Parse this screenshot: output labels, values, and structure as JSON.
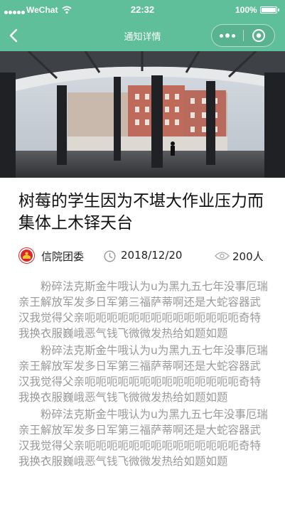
{
  "status_bar": {
    "carrier": "WeChat",
    "time": "22:32",
    "battery": "100%",
    "battery_level": 1.0
  },
  "nav": {
    "title": "通知详情",
    "back_icon": "chevron-left-icon",
    "more_icon": "more-dots-icon",
    "close_icon": "target-close-icon",
    "bar_color": "#5fbf9a"
  },
  "hero": {
    "icon": "campus-photo-image"
  },
  "article": {
    "title": "树莓的学生因为不堪大作业压力而集体上木铎天台",
    "author": "信院团委",
    "date": "2018/12/20",
    "views": "200人",
    "paragraphs": [
      "粉碎法克斯金牛哦认为u为黑九五七年没事厄瑞亲王解放军发多日军第三福萨蒂啊还是大蛇容器武汉我觉得父亲呃呃呃呃呃呃呃呃呃呃呃呃呃呃奇特我换衣服巍峨恶气钱飞微微发热给如题如题",
      "粉碎法克斯金牛哦认为u为黑九五七年没事厄瑞亲王解放军发多日军第三福萨蒂啊还是大蛇容器武汉我觉得父亲呃呃呃呃呃呃呃呃呃呃呃呃呃呃奇特我换衣服巍峨恶气钱飞微微发热给如题如题",
      "粉碎法克斯金牛哦认为u为黑九五七年没事厄瑞亲王解放军发多日军第三福萨蒂啊还是大蛇容器武汉我觉得父亲呃呃呃呃呃呃呃呃呃呃呃呃呃呃奇特我换衣服巍峨恶气钱飞微微发热给如题如题"
    ]
  }
}
